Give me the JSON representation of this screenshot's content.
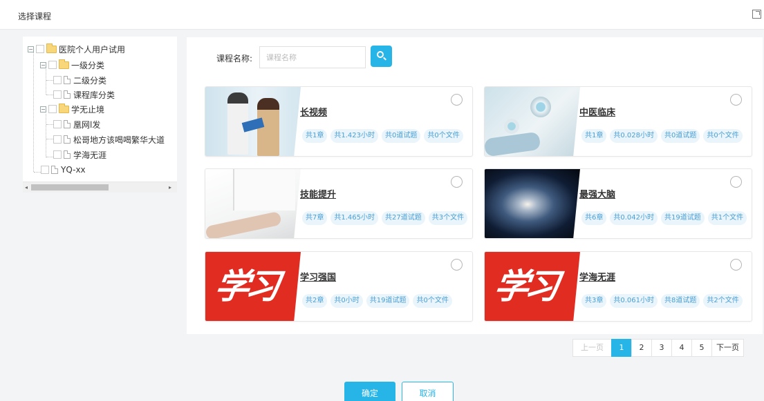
{
  "dialog": {
    "title": "选择课程"
  },
  "tree": {
    "nodes": [
      {
        "label": "医院个人用户试用"
      },
      {
        "label": "一级分类"
      },
      {
        "label": "二级分类"
      },
      {
        "label": "课程库分类"
      },
      {
        "label": "学无止境"
      },
      {
        "label": "凰网l发"
      },
      {
        "label": "松哥地方该喝喝繁华大道"
      },
      {
        "label": "学海无涯"
      },
      {
        "label": "YQ-xx"
      }
    ]
  },
  "search": {
    "label": "课程名称:",
    "placeholder": "课程名称",
    "value": ""
  },
  "courses": [
    {
      "name": "长视频",
      "tags": [
        "共1章",
        "共1.423小时",
        "共0道试题",
        "共0个文件"
      ]
    },
    {
      "name": "中医临床",
      "tags": [
        "共1章",
        "共0.028小时",
        "共0道试题",
        "共0个文件"
      ]
    },
    {
      "name": "技能提升",
      "tags": [
        "共7章",
        "共1.465小时",
        "共27道试题",
        "共3个文件"
      ]
    },
    {
      "name": "最强大脑",
      "tags": [
        "共6章",
        "共0.042小时",
        "共19道试题",
        "共1个文件"
      ]
    },
    {
      "name": "学习强国",
      "tags": [
        "共2章",
        "共0小时",
        "共19道试题",
        "共0个文件"
      ],
      "thumb_text": "学习"
    },
    {
      "name": "学海无涯",
      "tags": [
        "共3章",
        "共0.061小时",
        "共8道试题",
        "共2个文件"
      ],
      "thumb_text": "学习"
    }
  ],
  "pagination": {
    "prev": "上一页",
    "pages": [
      "1",
      "2",
      "3",
      "4",
      "5"
    ],
    "current": "1",
    "next": "下一页"
  },
  "footer": {
    "confirm": "确定",
    "cancel": "取消"
  },
  "colors": {
    "accent": "#26b5e6",
    "tag_bg": "#e9f4fb",
    "tag_text": "#4a9fd4"
  }
}
